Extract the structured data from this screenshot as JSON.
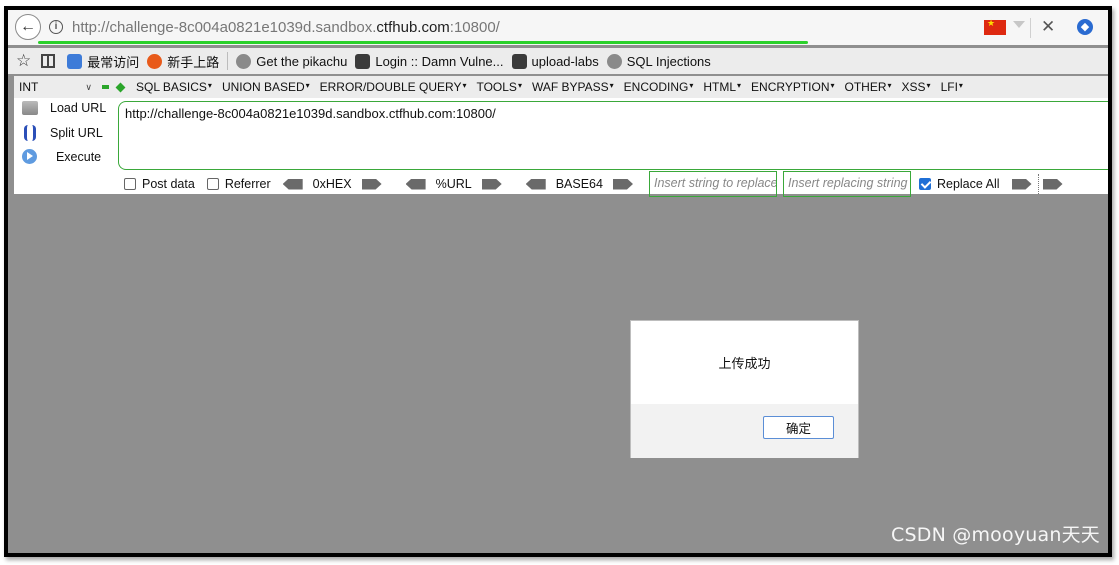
{
  "address_bar": {
    "url_main": "http://challenge-8c004a0821e1039d.sandbox.",
    "url_host": "ctfhub.com",
    "url_port": ":10800/"
  },
  "bookmarks": [
    {
      "label": "最常访问",
      "icon": "blue"
    },
    {
      "label": "新手上路",
      "icon": "fox"
    },
    {
      "label": "Get the pikachu",
      "icon": "globe"
    },
    {
      "label": "Login :: Damn Vulne...",
      "icon": "dark"
    },
    {
      "label": "upload-labs",
      "icon": "dark"
    },
    {
      "label": "SQL Injections",
      "icon": "globe"
    }
  ],
  "hackbar": {
    "type_select": "INT",
    "menus": [
      "SQL BASICS",
      "UNION BASED",
      "ERROR/DOUBLE QUERY",
      "TOOLS",
      "WAF BYPASS",
      "ENCODING",
      "HTML",
      "ENCRYPTION",
      "OTHER",
      "XSS",
      "LFI"
    ],
    "load_url": "Load URL",
    "split_url": "Split URL",
    "execute": "Execute",
    "url_value": "http://challenge-8c004a0821e1039d.sandbox.ctfhub.com:10800/",
    "post_data": "Post data",
    "referrer": "Referrer",
    "hex": "0xHEX",
    "urlenc": "%URL",
    "base64": "BASE64",
    "replace_placeholder": "Insert string to replace",
    "replacing_placeholder": "Insert replacing string",
    "replace_all": "Replace All"
  },
  "dialog": {
    "message": "上传成功",
    "ok_label": "确定"
  },
  "watermark": "CSDN @mooyuan天天",
  "colors": {
    "page_bg": "#8f8f8f",
    "accent_green": "#3aa83a",
    "progress_green": "#2bd12b",
    "checkbox_blue": "#1f6fd6"
  }
}
